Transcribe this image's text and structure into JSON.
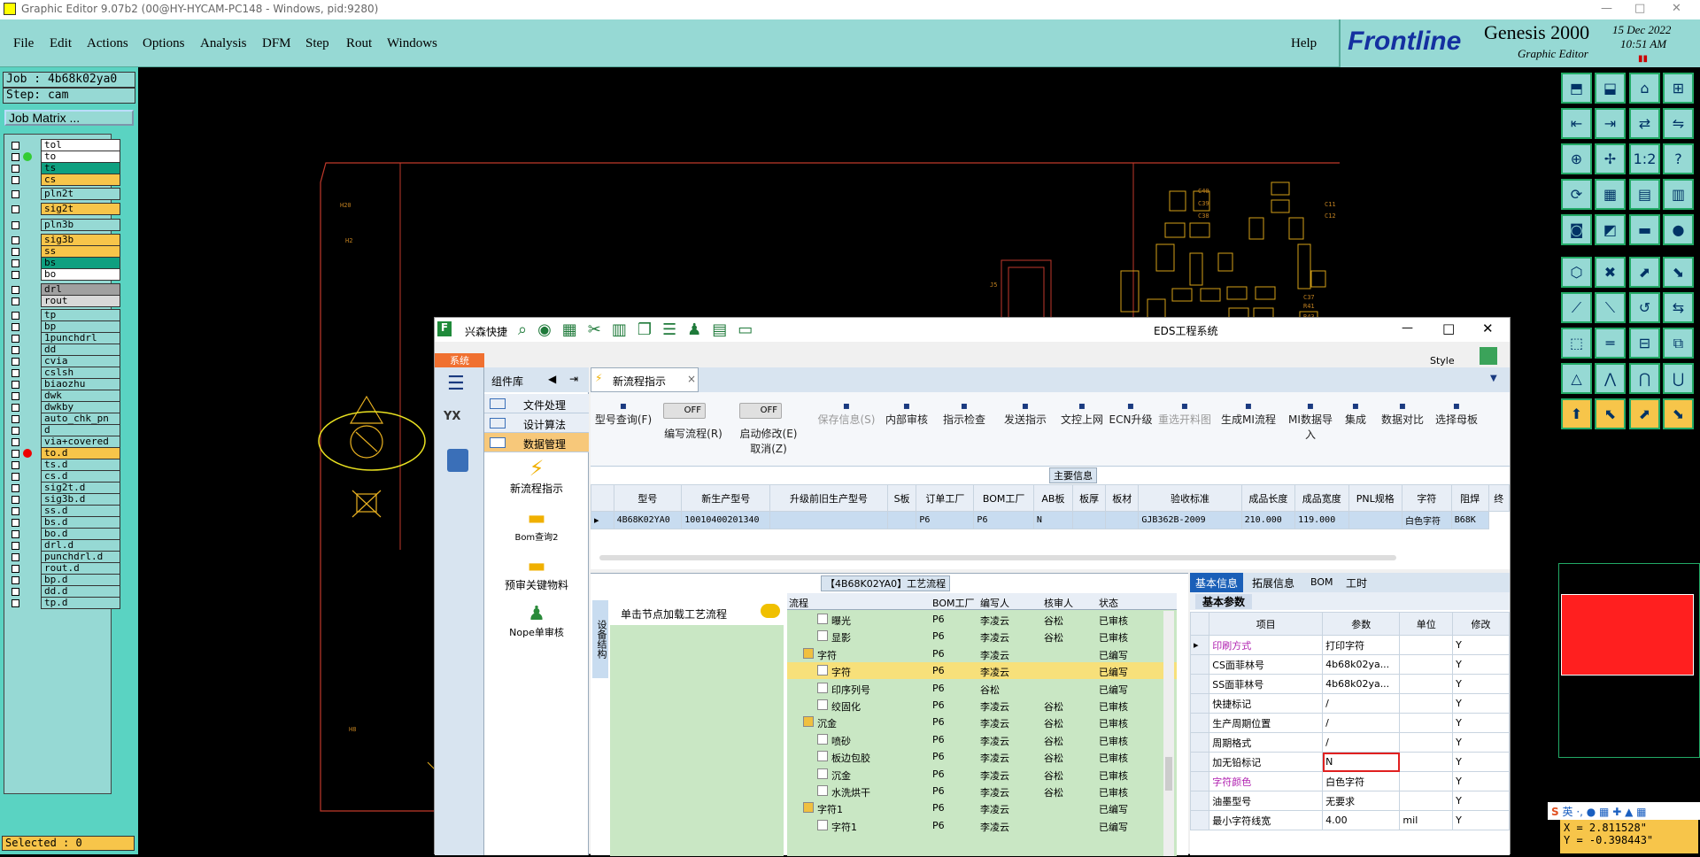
{
  "window": {
    "title": "Graphic Editor 9.07b2 (00@HY-HYCAM-PC148 - Windows, pid:9280)",
    "min": "—",
    "max": "□",
    "close": "✕"
  },
  "menu": {
    "items": [
      "File",
      "Edit",
      "Actions",
      "Options",
      "Analysis",
      "DFM",
      "Step",
      "Rout",
      "Windows"
    ],
    "help": "Help"
  },
  "brand": {
    "logo": "Frontline",
    "product": "Genesis 2000",
    "sub": "Graphic Editor",
    "date": "15 Dec 2022",
    "time": "10:51 AM"
  },
  "job": {
    "job": "Job : 4b68k02ya0",
    "step": "Step: cam",
    "matrix": "Job Matrix ..."
  },
  "layers": [
    {
      "name": "tol",
      "color": "#ffffff"
    },
    {
      "name": "to",
      "color": "#ffffff"
    },
    {
      "name": "ts",
      "color": "#0fa080"
    },
    {
      "name": "cs",
      "color": "#f7c54a"
    },
    {
      "name": "pln2t",
      "color": "#96d9d4"
    },
    {
      "name": "sig2t",
      "color": "#f7c54a"
    },
    {
      "name": "pln3b",
      "color": "#96d9d4"
    },
    {
      "name": "sig3b",
      "color": "#f7c54a"
    },
    {
      "name": "ss",
      "color": "#f7c54a"
    },
    {
      "name": "bs",
      "color": "#0fa080"
    },
    {
      "name": "bo",
      "color": "#ffffff"
    },
    {
      "name": "drl",
      "color": "#a0a0a0"
    },
    {
      "name": "rout",
      "color": "#d8d8d8"
    },
    {
      "name": "tp",
      "color": "#96d9d4"
    },
    {
      "name": "bp",
      "color": "#96d9d4"
    },
    {
      "name": "1punchdrl",
      "color": "#96d9d4"
    },
    {
      "name": "dd",
      "color": "#96d9d4"
    },
    {
      "name": "cvia",
      "color": "#96d9d4"
    },
    {
      "name": "cslsh",
      "color": "#96d9d4"
    },
    {
      "name": "biaozhu",
      "color": "#96d9d4"
    },
    {
      "name": "dwk",
      "color": "#96d9d4"
    },
    {
      "name": "dwkby",
      "color": "#96d9d4"
    },
    {
      "name": "auto_chk_pn",
      "color": "#96d9d4"
    },
    {
      "name": "d",
      "color": "#96d9d4"
    },
    {
      "name": "via+covered",
      "color": "#96d9d4"
    },
    {
      "name": "to.d",
      "color": "#f7c54a"
    },
    {
      "name": "ts.d",
      "color": "#96d9d4"
    },
    {
      "name": "cs.d",
      "color": "#96d9d4"
    },
    {
      "name": "sig2t.d",
      "color": "#96d9d4"
    },
    {
      "name": "sig3b.d",
      "color": "#96d9d4"
    },
    {
      "name": "ss.d",
      "color": "#96d9d4"
    },
    {
      "name": "bs.d",
      "color": "#96d9d4"
    },
    {
      "name": "bo.d",
      "color": "#96d9d4"
    },
    {
      "name": "drl.d",
      "color": "#96d9d4"
    },
    {
      "name": "punchdrl.d",
      "color": "#96d9d4"
    },
    {
      "name": "rout.d",
      "color": "#96d9d4"
    },
    {
      "name": "bp.d",
      "color": "#96d9d4"
    },
    {
      "name": "dd.d",
      "color": "#96d9d4"
    },
    {
      "name": "tp.d",
      "color": "#96d9d4"
    }
  ],
  "selected": "Selected : 0",
  "coords": {
    "x": "X = 2.811528\"",
    "y": "Y = -0.398443\""
  },
  "ime": {
    "lang": "英"
  },
  "canvas_labels": [
    "H20",
    "H2",
    "H8",
    "H21",
    "H17",
    "C40",
    "C39",
    "C38",
    "C25",
    "C22",
    "C11",
    "C12",
    "R35",
    "R34",
    "R36",
    "C37",
    "R41",
    "C16",
    "C14",
    "C15",
    "C13",
    "R43",
    "R42",
    "C6",
    "J5"
  ],
  "eds": {
    "app": "兴森快捷",
    "title": "EDS工程系统",
    "sys_tab": "系统",
    "style": "Style",
    "nav": {
      "header": "组件库",
      "items": [
        "文件处理",
        "设计算法",
        "数据管理"
      ],
      "tools": [
        "新流程指示",
        "Bom查询2",
        "预审关键物料",
        "Nope单审核"
      ]
    },
    "doc_tab": "新流程指示",
    "ribbon": [
      {
        "label": "型号查询(F)"
      },
      {
        "label": "编写流程(R)"
      },
      {
        "label": "启动修改(E)\n取消(Z)"
      },
      {
        "label": "保存信息(S)"
      },
      {
        "label": "内部审核"
      },
      {
        "label": "指示检查"
      },
      {
        "label": "发送指示"
      },
      {
        "label": "文控上网"
      },
      {
        "label": "ECN升级"
      },
      {
        "label": "重选开料图"
      },
      {
        "label": "生成MI流程"
      },
      {
        "label": "MI数据导入"
      },
      {
        "label": "集成"
      },
      {
        "label": "数据对比"
      },
      {
        "label": "选择母板"
      }
    ],
    "toggle_off": "OFF",
    "main_info": "主要信息",
    "grid_headers": [
      "型号",
      "新生产型号",
      "升级前旧生产型号",
      "S板",
      "订单工厂",
      "BOM工厂",
      "AB板",
      "板厚",
      "板材",
      "验收标准",
      "成品长度",
      "成品宽度",
      "PNL规格",
      "字符",
      "阻焊",
      "终"
    ],
    "grid_row": [
      "4B68K02YA0",
      "10010400201340",
      "",
      "",
      "P6",
      "P6",
      "N",
      "",
      "",
      "GJB362B-2009",
      "210.000",
      "119.000",
      "",
      "白色字符",
      "B68K"
    ],
    "process_title": "【4B68K02YA0】工艺流程",
    "process_hint": "单击节点加载工艺流程",
    "side_label": "设备结构",
    "proc_headers": [
      "流程",
      "BOM工厂",
      "编写人",
      "核审人",
      "状态"
    ],
    "proc_rows": [
      [
        "曝光",
        "P6",
        "李凌云",
        "谷松",
        "已审核"
      ],
      [
        "显影",
        "P6",
        "李凌云",
        "谷松",
        "已审核"
      ],
      [
        "字符",
        "P6",
        "李凌云",
        "",
        "已编写"
      ],
      [
        "字符",
        "P6",
        "李凌云",
        "",
        "已编写"
      ],
      [
        "印序列号",
        "P6",
        "谷松",
        "",
        "已编写"
      ],
      [
        "绞固化",
        "P6",
        "李凌云",
        "谷松",
        "已审核"
      ],
      [
        "沉金",
        "P6",
        "李凌云",
        "谷松",
        "已审核"
      ],
      [
        "喷砂",
        "P6",
        "李凌云",
        "谷松",
        "已审核"
      ],
      [
        "板边包胶",
        "P6",
        "李凌云",
        "谷松",
        "已审核"
      ],
      [
        "沉金",
        "P6",
        "李凌云",
        "谷松",
        "已审核"
      ],
      [
        "水洗烘干",
        "P6",
        "李凌云",
        "谷松",
        "已审核"
      ],
      [
        "字符1",
        "P6",
        "李凌云",
        "",
        "已编写"
      ],
      [
        "字符1",
        "P6",
        "李凌云",
        "",
        "已编写"
      ]
    ],
    "detail_tabs": [
      "基本信息",
      "拓展信息",
      "BOM",
      "工时"
    ],
    "detail_sub": "基本参数",
    "detail_headers": [
      "项目",
      "参数",
      "单位",
      "修改"
    ],
    "detail_rows": [
      [
        "印刷方式",
        "打印字符",
        "",
        "Y"
      ],
      [
        "CS面菲林号",
        "4b68k02ya...",
        "",
        "Y"
      ],
      [
        "SS面菲林号",
        "4b68k02ya...",
        "",
        "Y"
      ],
      [
        "快捷标记",
        "/",
        "",
        "Y"
      ],
      [
        "生产周期位置",
        "/",
        "",
        "Y"
      ],
      [
        "周期格式",
        "/",
        "",
        "Y"
      ],
      [
        "加无铅标记",
        "N",
        "",
        "Y"
      ],
      [
        "字符颜色",
        "白色字符",
        "",
        "Y"
      ],
      [
        "油墨型号",
        "无要求",
        "",
        "Y"
      ],
      [
        "最小字符线宽",
        "4.00",
        "mil",
        "Y"
      ]
    ]
  }
}
